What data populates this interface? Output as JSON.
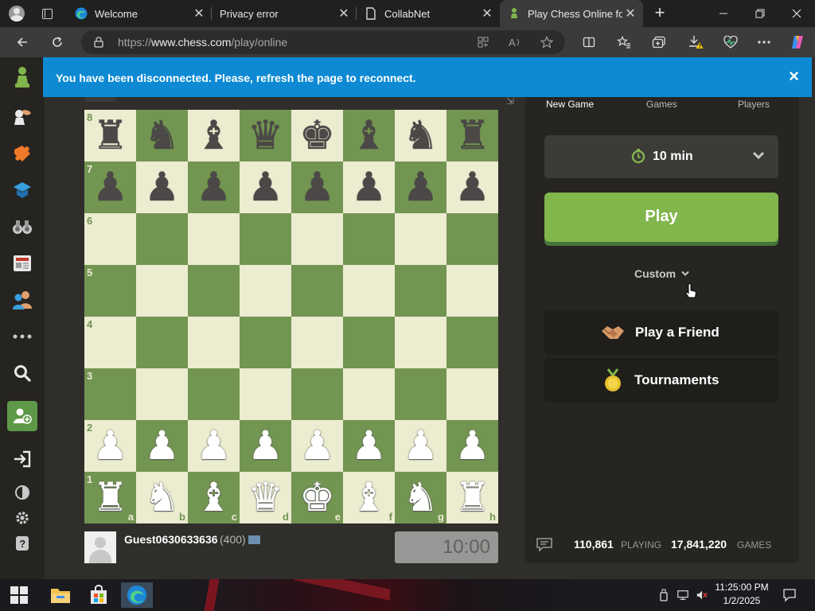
{
  "browser": {
    "tabs": [
      {
        "label": "Welcome",
        "icon": "edge-icon"
      },
      {
        "label": "Privacy error",
        "icon": "none"
      },
      {
        "label": "CollabNet",
        "icon": "page-icon"
      },
      {
        "label": "Play Chess Online for",
        "icon": "chess-pawn-icon",
        "active": true
      }
    ],
    "new_tab": "+",
    "url_prefix": "https://",
    "url_host": "www.chess.com",
    "url_path": "/play/online"
  },
  "banner": {
    "message": "You have been disconnected. Please, refresh the page to reconnect.",
    "close": "×"
  },
  "board": {
    "ranks": [
      "8",
      "7",
      "6",
      "5",
      "4",
      "3",
      "2",
      "1"
    ],
    "files": [
      "a",
      "b",
      "c",
      "d",
      "e",
      "f",
      "g",
      "h"
    ],
    "rows": [
      [
        "br",
        "bn",
        "bb",
        "bq",
        "bk",
        "bb",
        "bn",
        "br"
      ],
      [
        "bp",
        "bp",
        "bp",
        "bp",
        "bp",
        "bp",
        "bp",
        "bp"
      ],
      [
        "",
        "",
        "",
        "",
        "",
        "",
        "",
        ""
      ],
      [
        "",
        "",
        "",
        "",
        "",
        "",
        "",
        ""
      ],
      [
        "",
        "",
        "",
        "",
        "",
        "",
        "",
        ""
      ],
      [
        "",
        "",
        "",
        "",
        "",
        "",
        "",
        ""
      ],
      [
        "wp",
        "wp",
        "wp",
        "wp",
        "wp",
        "wp",
        "wp",
        "wp"
      ],
      [
        "wr",
        "wn",
        "wb",
        "wq",
        "wk",
        "wb",
        "wn",
        "wr"
      ]
    ],
    "glyphs": {
      "k": "♚",
      "q": "♛",
      "r": "♜",
      "b": "♝",
      "n": "♞",
      "p": "♟"
    },
    "colors": {
      "light": "#ebecd0",
      "dark": "#739552"
    }
  },
  "player": {
    "name": "Guest0630633636",
    "rating": "(400)",
    "clock": "10:00"
  },
  "panel": {
    "tabs": [
      "New Game",
      "Games",
      "Players"
    ],
    "time_control": "10 min",
    "play_label": "Play",
    "custom_label": "Custom",
    "play_friend_label": "Play a Friend",
    "tournaments_label": "Tournaments",
    "playing_count": "110,861",
    "playing_label": "PLAYING",
    "games_count": "17,841,220",
    "games_label": "GAMES",
    "accent": "#81b64c"
  },
  "taskbar": {
    "time": "11:25:00 PM",
    "date": "1/2/2025"
  }
}
